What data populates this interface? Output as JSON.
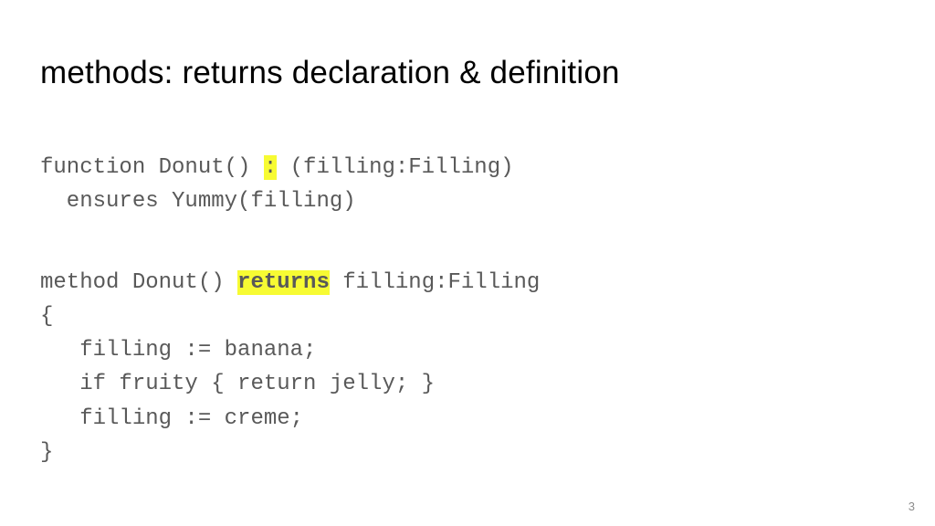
{
  "title": "methods: returns declaration & definition",
  "code": {
    "func": {
      "l1a": "function Donut() ",
      "l1_hl": ":",
      "l1b": " (filling:Filling)",
      "l2": "  ensures Yummy(filling)"
    },
    "meth": {
      "l1a": "method Donut() ",
      "l1_hl": "returns",
      "l1b": " filling:Filling",
      "l2": "{",
      "l3": "   filling := banana;",
      "l4": "   if fruity { return jelly; }",
      "l5": "   filling := creme;",
      "l6": "}"
    }
  },
  "page_number": "3"
}
